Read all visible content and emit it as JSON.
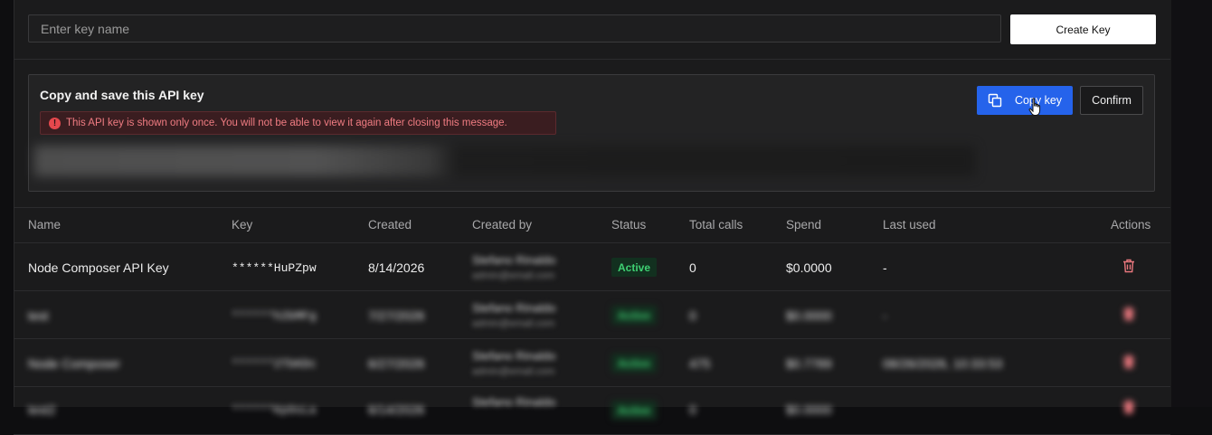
{
  "create": {
    "placeholder": "Enter key name",
    "button_label": "Create Key"
  },
  "save_notice": {
    "title": "Copy and save this API key",
    "warning": "This API key is shown only once. You will not be able to view it again after closing this message.",
    "warning_icon": "alert-circle-icon",
    "copy_label": "Copy key",
    "confirm_label": "Confirm",
    "colors": {
      "copy_button": "#2563eb",
      "warning_text": "#f07c82"
    }
  },
  "table": {
    "headers": [
      "Name",
      "Key",
      "Created",
      "Created by",
      "Status",
      "Total calls",
      "Spend",
      "Last used",
      "Actions"
    ],
    "rows": [
      {
        "name": "Node Composer API Key",
        "key": "******HuPZpw",
        "created": "8/14/2026",
        "created_by_name": "Stefano Rinaldo",
        "created_by_email": "admin@email.com",
        "status": "Active",
        "total_calls": "0",
        "spend": "$0.0000",
        "last_used": "-"
      },
      {
        "name": "test",
        "key": "******h2bMFg",
        "created": "7/27/2026",
        "created_by_name": "Stefano Rinaldo",
        "created_by_email": "admin@email.com",
        "status": "Active",
        "total_calls": "0",
        "spend": "$0.0000",
        "last_used": "-"
      },
      {
        "name": "Node Composer",
        "key": "******2TbKDc",
        "created": "6/27/2026",
        "created_by_name": "Stefano Rinaldo",
        "created_by_email": "admin@email.com",
        "status": "Active",
        "total_calls": "475",
        "spend": "$0.7789",
        "last_used": "08/26/2026, 10:33:53"
      },
      {
        "name": "test2",
        "key": "******Kp9sLa",
        "created": "6/14/2026",
        "created_by_name": "Stefano Rinaldo",
        "created_by_email": "admin@email.com",
        "status": "Active",
        "total_calls": "0",
        "spend": "$0.0000",
        "last_used": "-"
      }
    ]
  }
}
